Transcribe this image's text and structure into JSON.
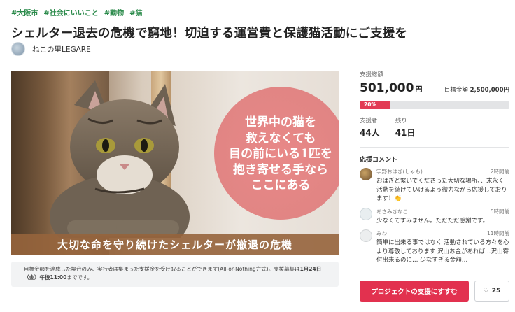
{
  "tags": [
    "#大阪市",
    "#社会にいいこと",
    "#動物",
    "#猫"
  ],
  "title": "シェルター退去の危機で窮地！切迫する運営費と保護猫活動にご支援を",
  "owner": {
    "name": "ねこの里LEGARE"
  },
  "hero": {
    "circle_lines": [
      "世界中の猫を",
      "救えなくても",
      "目の前にいる1匹を",
      "抱き寄せる手なら",
      "ここにある"
    ],
    "banner": "大切な命を守り続けたシェルターが撤退の危機"
  },
  "notice": {
    "text": "目標金額を達成した場合のみ、実行者は集まった支援金を受け取ることができます(All-or-Nothing方式)。支援募集は",
    "deadline": "1月24日（金）午後11:00",
    "suffix": "までです。"
  },
  "funding": {
    "total_label": "支援総額",
    "total": "501,000",
    "unit": "円",
    "goal_label": "目標金額",
    "goal": "2,500,000円",
    "percent_label": "20%",
    "percent": 20,
    "supporters_label": "支援者",
    "supporters": "44人",
    "remaining_label": "残り",
    "remaining": "41日"
  },
  "comments": {
    "title": "応援コメント",
    "items": [
      {
        "name": "宇野おはぎ(しゃも)",
        "time": "2時間前",
        "text": "おはぎと繋いでくださった大切な場所、、末永く活動を続けていけるよう微力ながら応援しております！👏"
      },
      {
        "name": "あさみきなこ",
        "time": "5時間前",
        "text": "少なくてすみません。ただただ感謝です。"
      },
      {
        "name": "みわ",
        "time": "11時間前",
        "text": "簡単に出来る事ではなく 活動されている方々を心より尊敬しております 沢山お金があれば…沢山寄付出来るのに… 少なすぎる金額…"
      }
    ]
  },
  "actions": {
    "support": "プロジェクトの支援にすすむ",
    "fav_count": "25"
  }
}
